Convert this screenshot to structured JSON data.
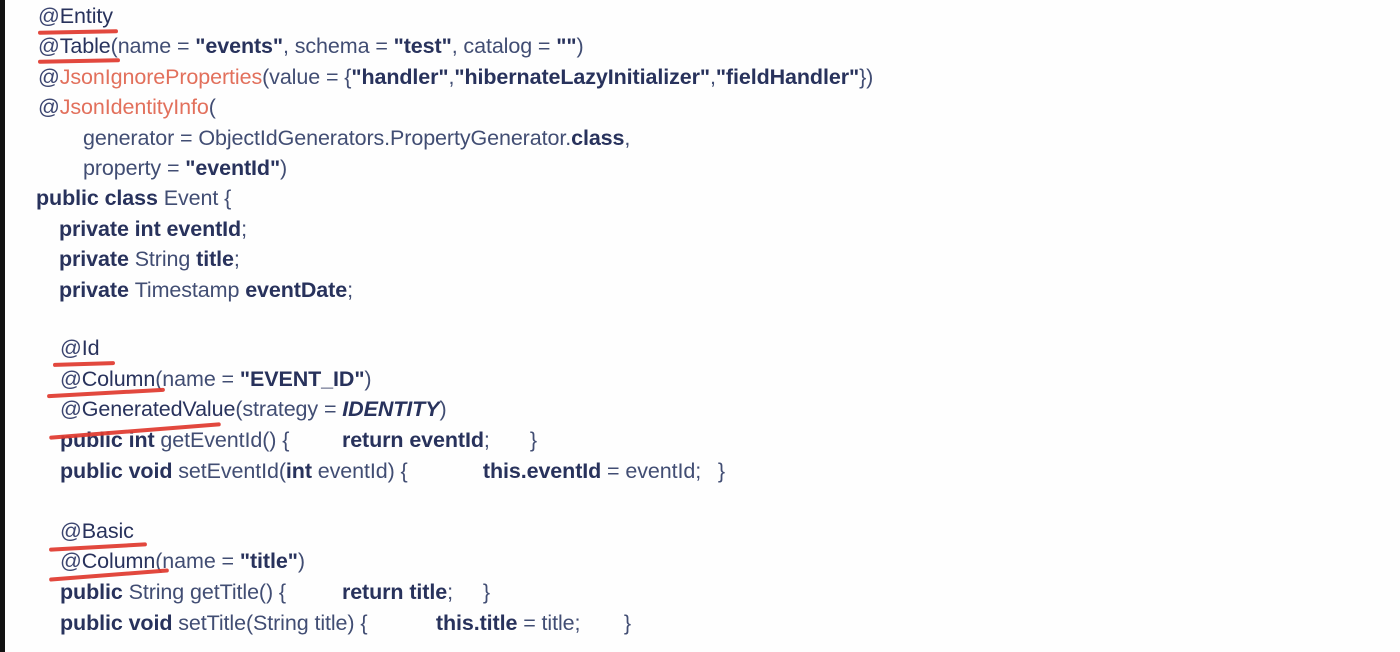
{
  "slide": {
    "title": "Java JPA Entity class source code with red marker annotations",
    "background_color": "#fdfdfd",
    "code_text_color": "#2f3a63",
    "annotation_color": "#e2705c",
    "marker_color": "#e03a2f",
    "edge_bar_color": "#121212"
  },
  "code": {
    "language": "Java",
    "class_name": "Event",
    "lines": [
      {
        "id": "l01",
        "indent": 0,
        "text": "@Entity"
      },
      {
        "id": "l02",
        "indent": 0,
        "text": "@Table(name = \"events\", schema = \"test\", catalog = \"\")"
      },
      {
        "id": "l03",
        "indent": 0,
        "text": "@JsonIgnoreProperties(value = {\"handler\",\"hibernateLazyInitializer\",\"fieldHandler\"})"
      },
      {
        "id": "l04",
        "indent": 0,
        "text": "@JsonIdentityInfo("
      },
      {
        "id": "l05",
        "indent": 2,
        "text": "generator = ObjectIdGenerators.PropertyGenerator.class,"
      },
      {
        "id": "l06",
        "indent": 2,
        "text": "property = \"eventId\")"
      },
      {
        "id": "l07",
        "indent": 0,
        "text": "public class Event {"
      },
      {
        "id": "l08",
        "indent": 1,
        "text": "private int eventId;"
      },
      {
        "id": "l09",
        "indent": 1,
        "text": "private String title;"
      },
      {
        "id": "l10",
        "indent": 1,
        "text": "private Timestamp eventDate;"
      },
      {
        "id": "l11",
        "indent": 0,
        "text": ""
      },
      {
        "id": "l12",
        "indent": 1,
        "text": "@Id"
      },
      {
        "id": "l13",
        "indent": 1,
        "text": "@Column(name = \"EVENT_ID\")"
      },
      {
        "id": "l14",
        "indent": 1,
        "text": "@GeneratedValue(strategy = IDENTITY)"
      },
      {
        "id": "l15",
        "indent": 1,
        "text": "public int getEventId() {      return eventId;   }"
      },
      {
        "id": "l16",
        "indent": 1,
        "text": "public void setEventId(int eventId) {      this.eventId = eventId;   }"
      },
      {
        "id": "l17",
        "indent": 0,
        "text": ""
      },
      {
        "id": "l18",
        "indent": 1,
        "text": "@Basic"
      },
      {
        "id": "l19",
        "indent": 1,
        "text": "@Column(name = \"title\")"
      },
      {
        "id": "l20",
        "indent": 1,
        "text": "public String getTitle() {      return title;   }"
      },
      {
        "id": "l21",
        "indent": 1,
        "text": "public void setTitle(String title) {      this.title = title;   }"
      }
    ],
    "annotations_highlighted": [
      "@Entity",
      "@Table",
      "@Id",
      "@Column",
      "public int",
      "@Basic",
      "@Column"
    ],
    "red_colored_annotations": [
      "JsonIgnoreProperties",
      "JsonIdentityInfo"
    ],
    "string_literals": [
      "\"events\"",
      "\"test\"",
      "\"\"",
      "\"handler\"",
      "\"hibernateLazyInitializer\"",
      "\"fieldHandler\"",
      "\"eventId\"",
      "\"EVENT_ID\"",
      "\"title\""
    ],
    "fields": [
      {
        "modifier": "private",
        "type": "int",
        "name": "eventId"
      },
      {
        "modifier": "private",
        "type": "String",
        "name": "title"
      },
      {
        "modifier": "private",
        "type": "Timestamp",
        "name": "eventDate"
      }
    ],
    "methods": [
      {
        "signature": "public int getEventId()",
        "body": "return eventId;"
      },
      {
        "signature": "public void setEventId(int eventId)",
        "body": "this.eventId = eventId;"
      },
      {
        "signature": "public String getTitle()",
        "body": "return title;"
      },
      {
        "signature": "public void setTitle(String title)",
        "body": "this.title = title;"
      }
    ]
  }
}
